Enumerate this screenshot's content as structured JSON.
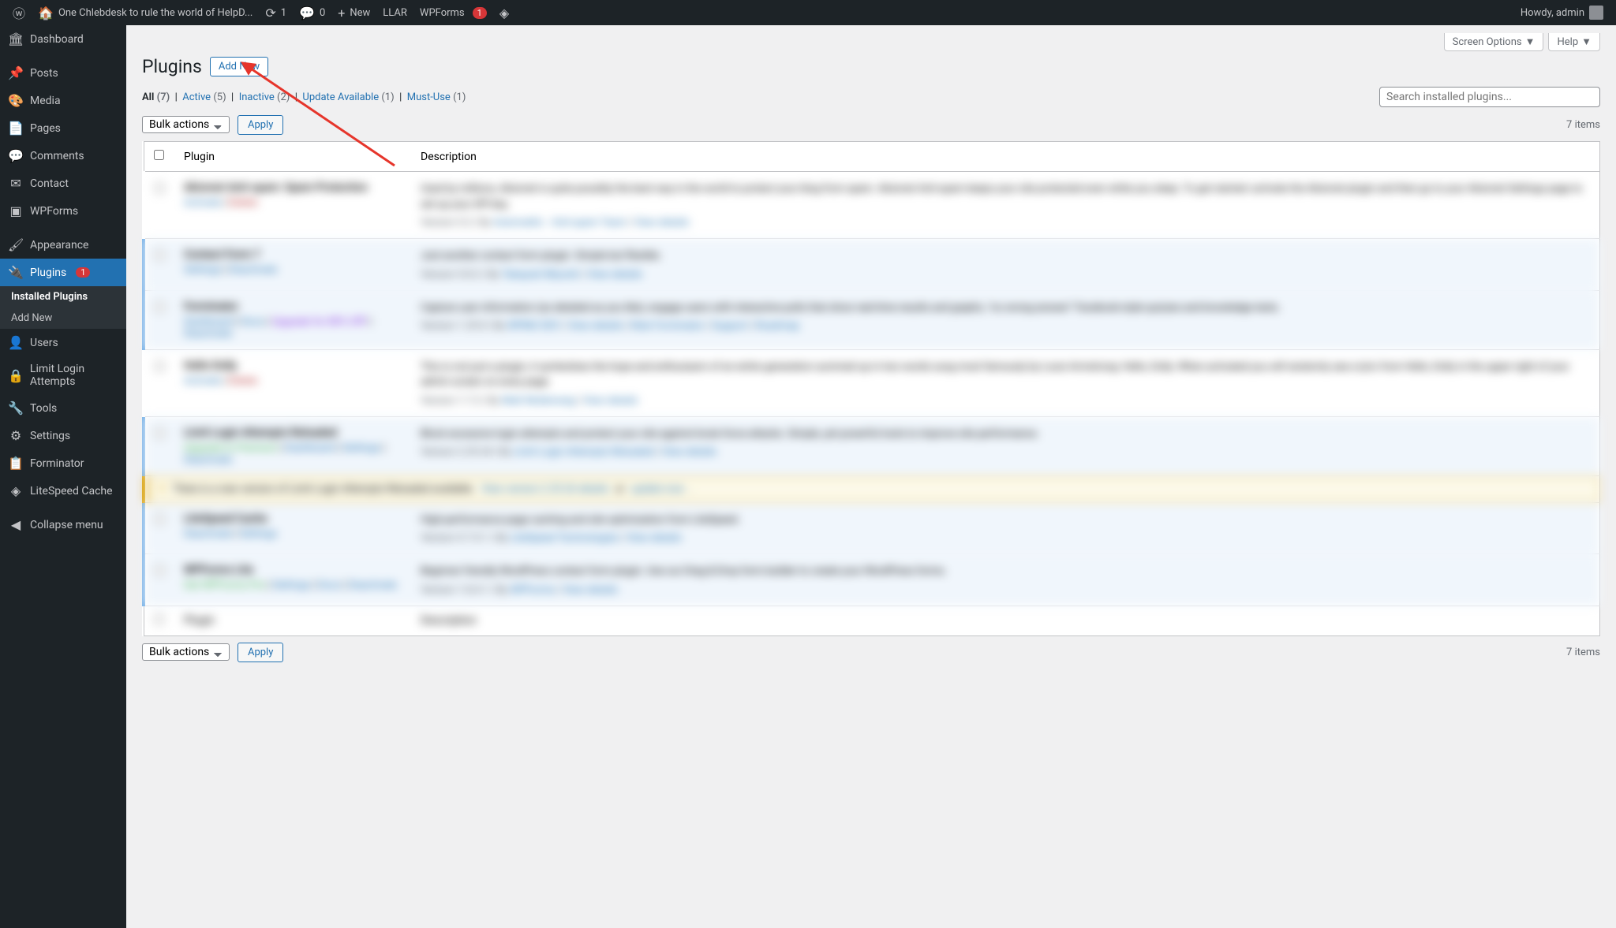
{
  "adminbar": {
    "site_name": "One Chlebdesk to rule the world of HelpD...",
    "updates": "1",
    "comments": "0",
    "new": "New",
    "llar": "LLAR",
    "wpforms": "WPForms",
    "wpforms_badge": "1",
    "howdy": "Howdy, admin"
  },
  "sidebar": {
    "dashboard": "Dashboard",
    "posts": "Posts",
    "media": "Media",
    "pages": "Pages",
    "comments": "Comments",
    "contact": "Contact",
    "wpforms": "WPForms",
    "appearance": "Appearance",
    "plugins": "Plugins",
    "plugins_badge": "1",
    "installed_plugins": "Installed Plugins",
    "add_new": "Add New",
    "users": "Users",
    "limit_login": "Limit Login Attempts",
    "tools": "Tools",
    "settings": "Settings",
    "forminator": "Forminator",
    "litespeed": "LiteSpeed Cache",
    "collapse": "Collapse menu"
  },
  "topactions": {
    "screen_options": "Screen Options",
    "help": "Help"
  },
  "page": {
    "title": "Plugins",
    "add_new": "Add New"
  },
  "filters": {
    "all": "All",
    "all_count": "(7)",
    "active": "Active",
    "active_count": "(5)",
    "inactive": "Inactive",
    "inactive_count": "(2)",
    "update": "Update Available",
    "update_count": "(1)",
    "mustuse": "Must-Use",
    "mustuse_count": "(1)"
  },
  "search": {
    "placeholder": "Search installed plugins..."
  },
  "bulk": {
    "label": "Bulk actions",
    "apply": "Apply"
  },
  "items_count": "7 items",
  "table": {
    "plugin_header": "Plugin",
    "description_header": "Description"
  }
}
